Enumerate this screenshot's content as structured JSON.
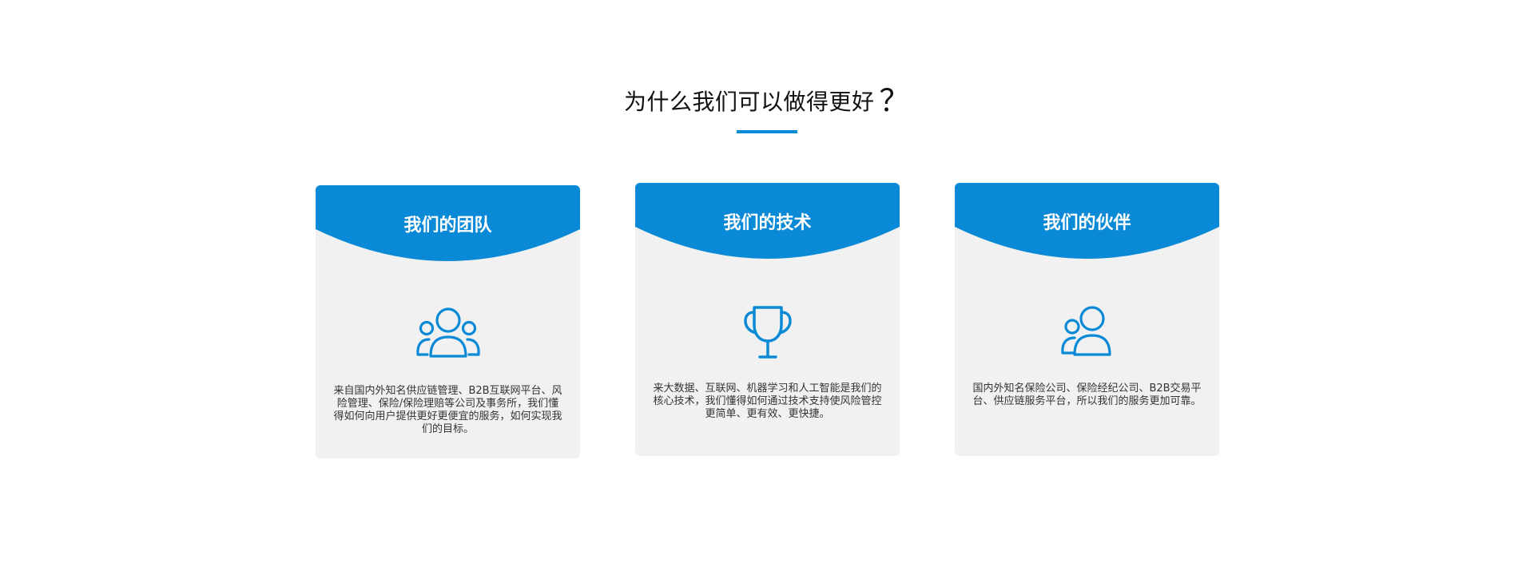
{
  "section": {
    "title": "为什么我们可以做得更好",
    "title_mark": "？",
    "accent_color": "#0a8ad6"
  },
  "cards": [
    {
      "title": "我们的团队",
      "icon": "team-icon",
      "text": "来自国内外知名供应链管理、B2B互联网平台、风险管理、保险/保险理赔等公司及事务所，我们懂得如何向用户提供更好更便宜的服务，如何实现我们的目标。"
    },
    {
      "title": "我们的技术",
      "icon": "trophy-icon",
      "text": "来大数据、互联网、机器学习和人工智能是我们的核心技术，我们懂得如何通过技术支持使风险管控更简单、更有效、更快捷。"
    },
    {
      "title": "我们的伙伴",
      "icon": "partners-icon",
      "text": "国内外知名保险公司、保险经纪公司、B2B交易平台、供应链服务平台，所以我们的服务更加可靠。"
    }
  ]
}
